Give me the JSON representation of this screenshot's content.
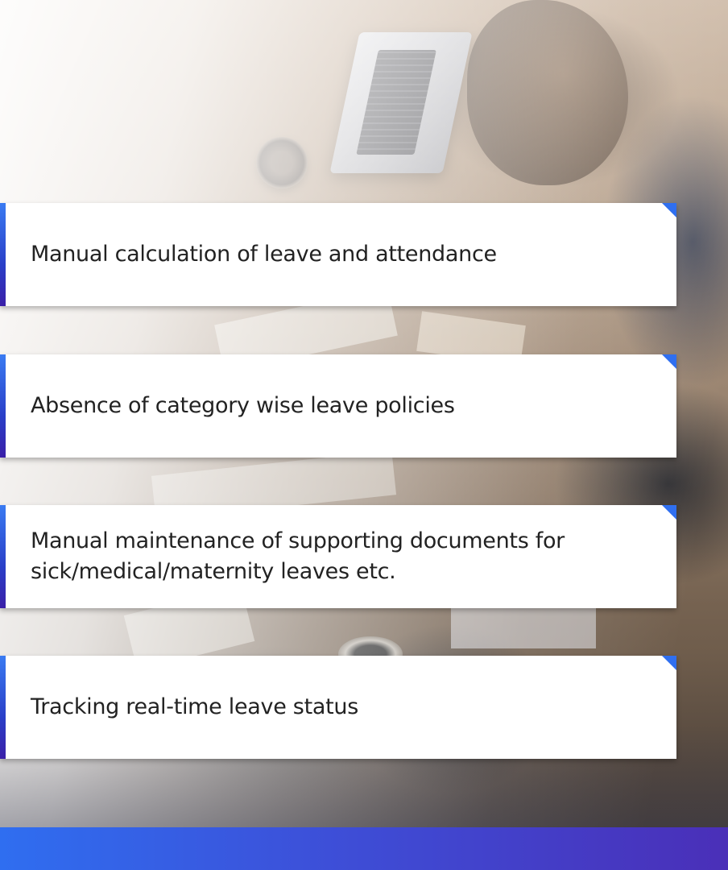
{
  "items": [
    {
      "label": "Manual calculation of leave and attendance"
    },
    {
      "label": "Absence of category wise leave policies"
    },
    {
      "label": "Manual maintenance of supporting documents for sick/medical/maternity leaves etc."
    },
    {
      "label": "Tracking real-time leave status"
    }
  ],
  "colors": {
    "accent_blue": "#2f6ff0",
    "accent_purple": "#4a2fb8",
    "card_background": "#ffffff",
    "text": "#222222"
  },
  "icons": [
    "card-corner-triangle"
  ]
}
